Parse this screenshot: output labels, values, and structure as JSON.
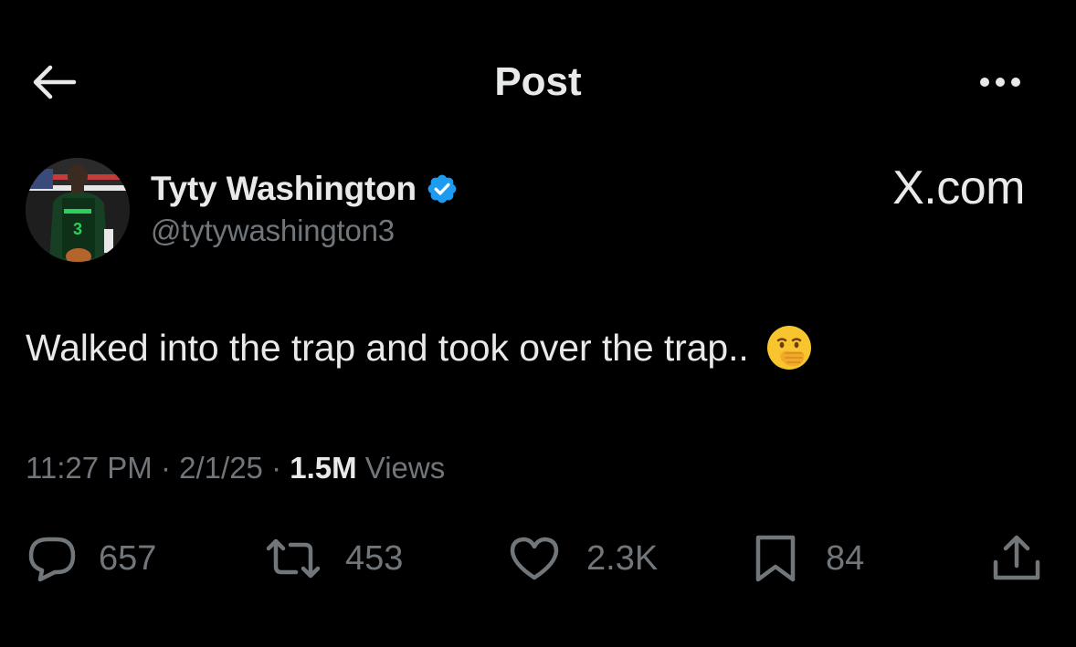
{
  "header": {
    "title": "Post",
    "back_icon": "arrow-left-icon",
    "more_icon": "more-horizontal-icon"
  },
  "author": {
    "display_name": "Tyty Washington",
    "handle": "@tytywashington3",
    "verified": true,
    "verified_color": "#1d9bf0",
    "jersey_number": "3"
  },
  "watermark": "X.com",
  "post": {
    "text": "Walked into the trap and took over the trap..",
    "emoji": "face-with-hand-over-mouth"
  },
  "meta": {
    "time": "11:27 PM",
    "separator": "·",
    "date": "2/1/25",
    "views_count": "1.5M",
    "views_label": "Views"
  },
  "actions": {
    "replies": "657",
    "reposts": "453",
    "likes": "2.3K",
    "bookmarks": "84"
  },
  "colors": {
    "background": "#000000",
    "text_primary": "#e7e9ea",
    "text_secondary": "#71767b",
    "accent": "#1d9bf0"
  }
}
